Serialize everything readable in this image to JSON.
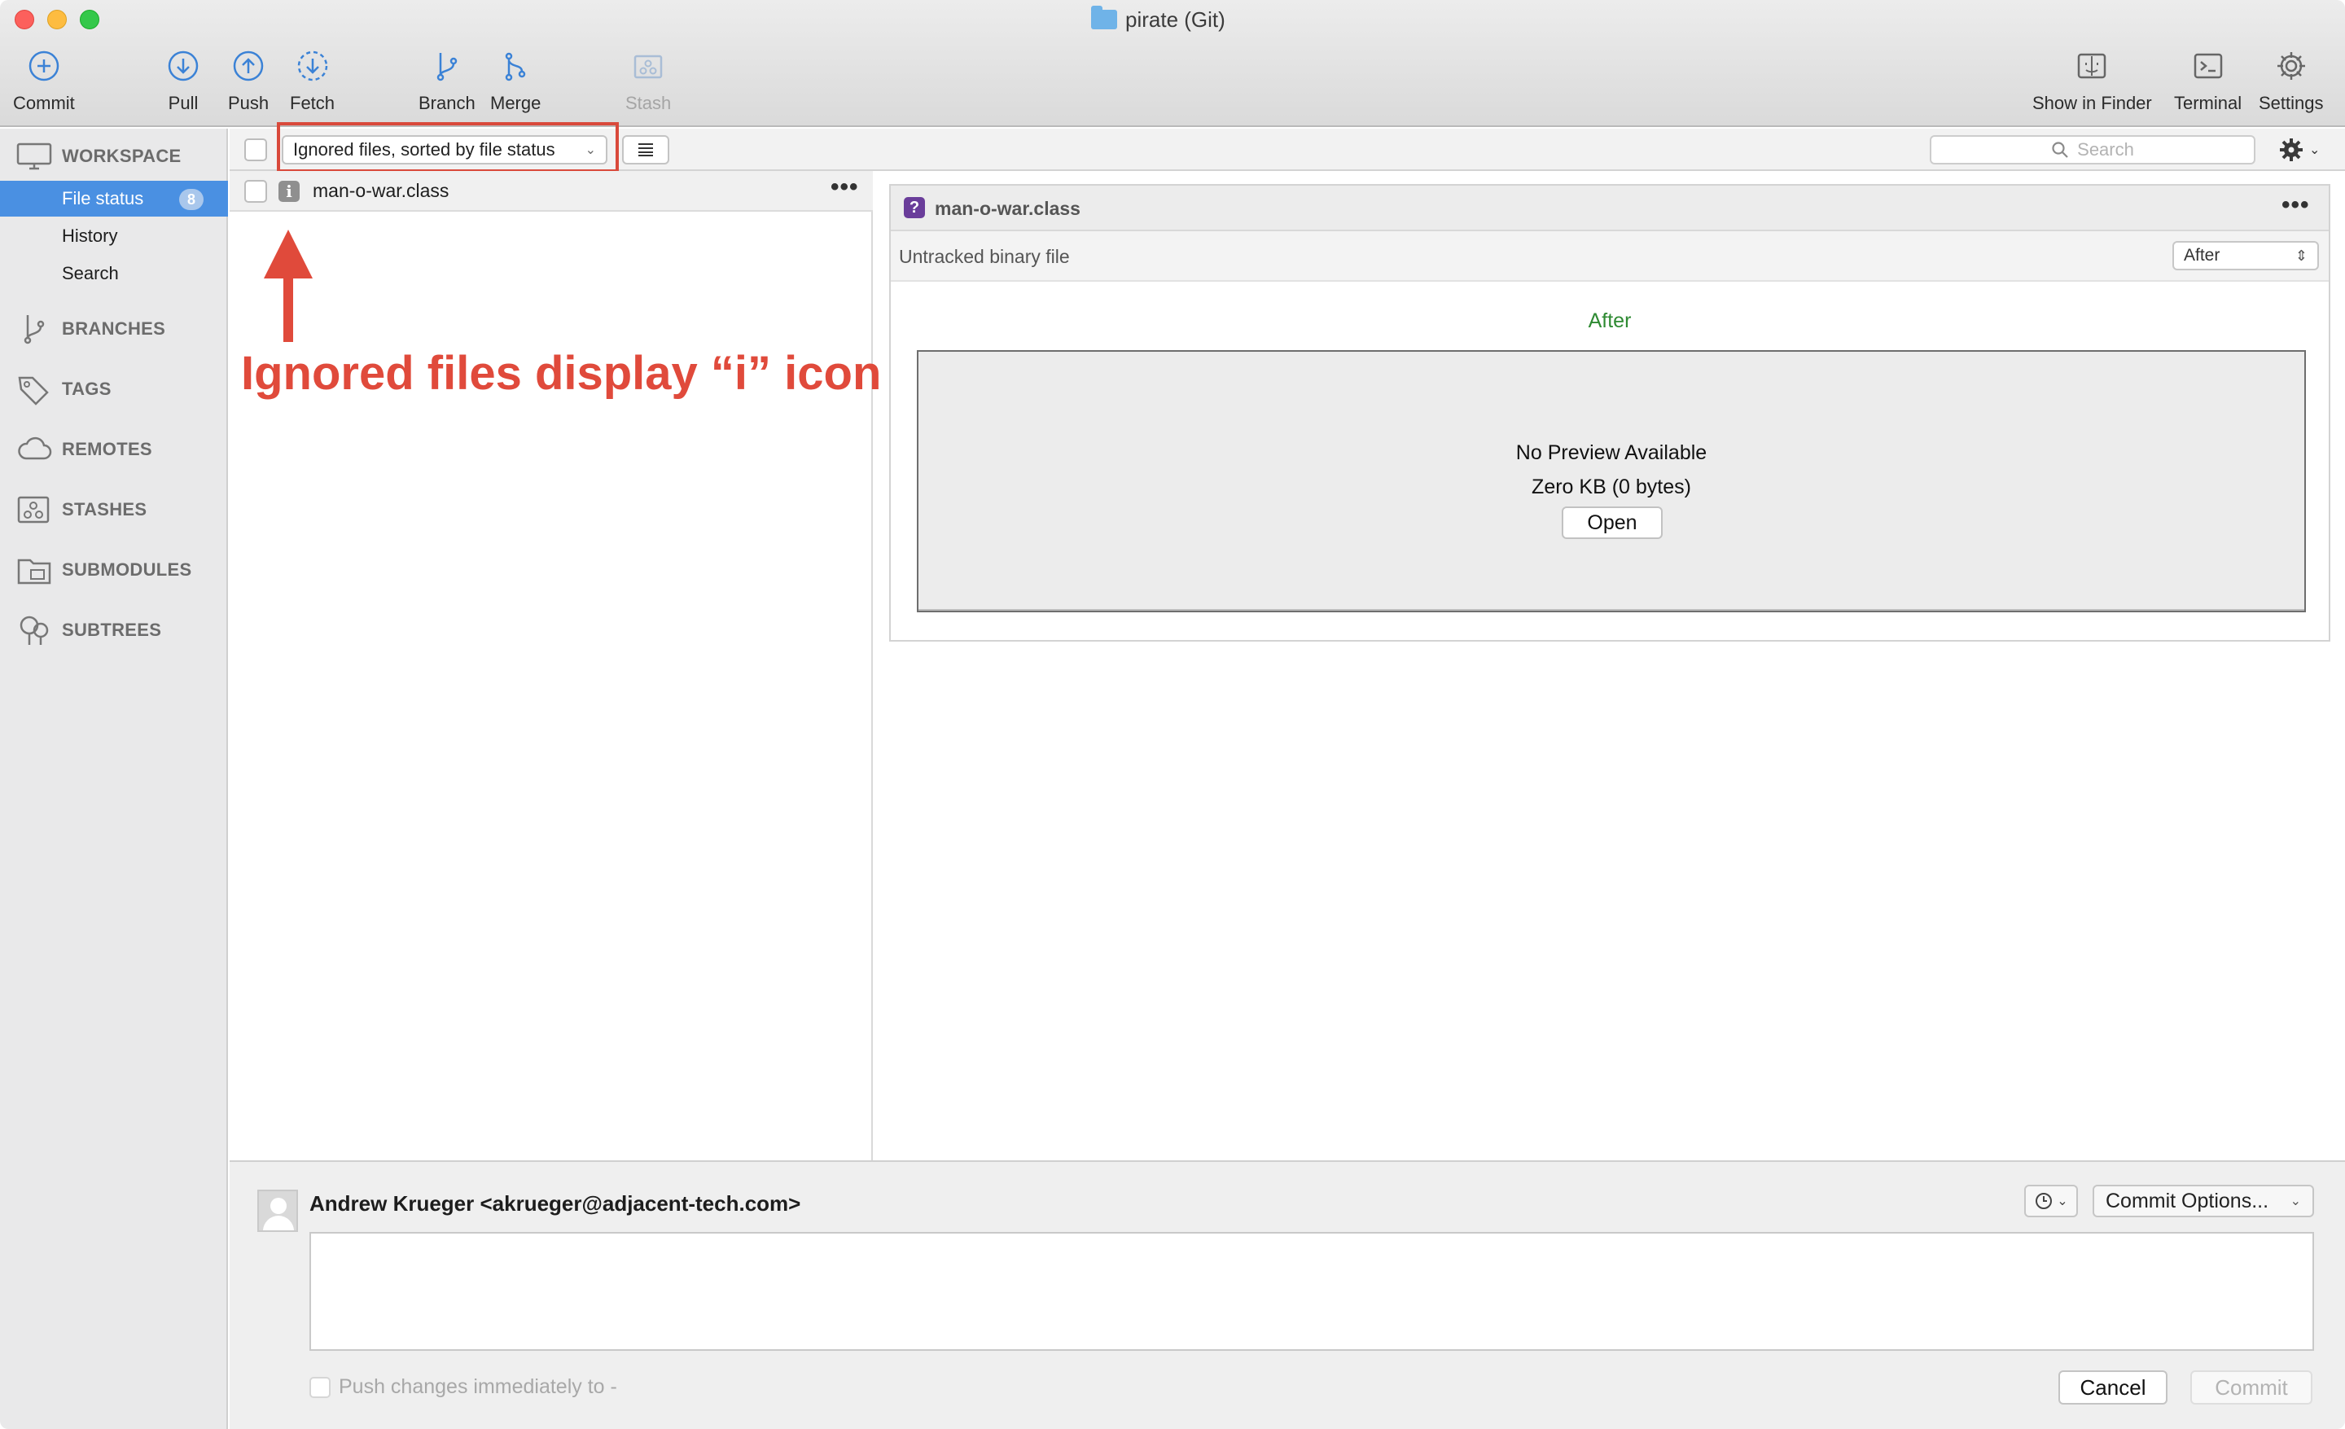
{
  "window": {
    "title": "pirate (Git)"
  },
  "toolbar": {
    "commit": "Commit",
    "pull": "Pull",
    "push": "Push",
    "fetch": "Fetch",
    "branch": "Branch",
    "merge": "Merge",
    "stash": "Stash",
    "show_in_finder": "Show in Finder",
    "terminal": "Terminal",
    "settings": "Settings"
  },
  "sidebar": {
    "workspace": "WORKSPACE",
    "items": [
      {
        "label": "File status",
        "badge": "8",
        "active": true
      },
      {
        "label": "History"
      },
      {
        "label": "Search"
      }
    ],
    "sections": {
      "branches": "BRANCHES",
      "tags": "TAGS",
      "remotes": "REMOTES",
      "stashes": "STASHES",
      "submodules": "SUBMODULES",
      "subtrees": "SUBTREES"
    }
  },
  "filter": {
    "selected": "Ignored files, sorted by file status",
    "search_placeholder": "Search"
  },
  "files": [
    {
      "name": "man-o-war.class",
      "status_icon": "i"
    }
  ],
  "annotation": {
    "text": "Ignored files display “i” icon",
    "color": "#e04a3b"
  },
  "preview": {
    "status_icon": "?",
    "file_name": "man-o-war.class",
    "subtitle": "Untracked binary file",
    "view_mode": "After",
    "heading": "After",
    "no_preview": "No Preview Available",
    "size": "Zero KB (0 bytes)",
    "open": "Open"
  },
  "commit": {
    "author": "Andrew Krueger <akrueger@adjacent-tech.com>",
    "options": "Commit Options...",
    "message": "",
    "push_label": "Push changes immediately to -",
    "cancel": "Cancel",
    "commit": "Commit"
  },
  "colors": {
    "accent": "#4a90e2",
    "after_green": "#2e8a32",
    "untracked_purple": "#6a3d9a",
    "annotation_red": "#e04a3b"
  }
}
